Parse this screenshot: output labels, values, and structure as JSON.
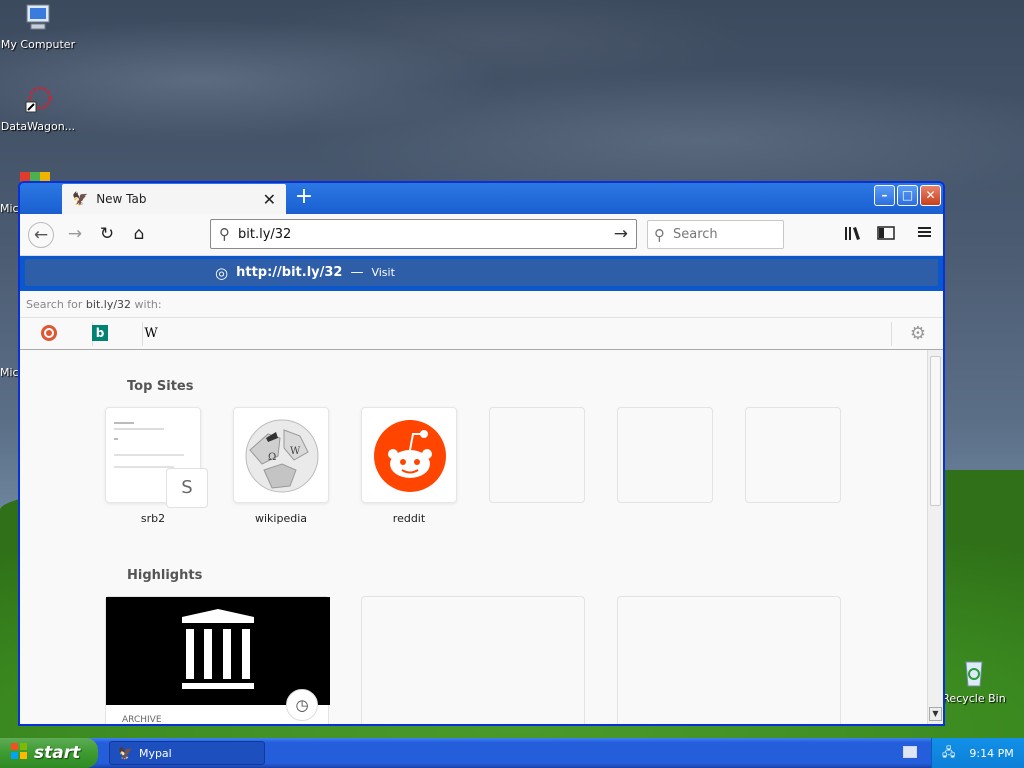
{
  "desktop": {
    "icons": [
      {
        "label": "My Computer"
      },
      {
        "label": "DataWagon..."
      },
      {
        "label": "Mic"
      },
      {
        "label": "Mic"
      },
      {
        "label": "Recycle Bin"
      }
    ]
  },
  "browser": {
    "tab": {
      "title": "New Tab",
      "close": "✕"
    },
    "new_tab": "+",
    "window_controls": {
      "minimize": "–",
      "maximize": "□",
      "close": "✕"
    },
    "url": "bit.ly/32",
    "search_placeholder": "Search",
    "suggestion": {
      "url": "http://bit.ly/32",
      "dash": "—",
      "action": "Visit"
    },
    "search_with": {
      "prefix": "Search for",
      "term": "bit.ly/32",
      "suffix": "with:"
    },
    "engines": [
      {
        "name": "duckduckgo-icon",
        "glyph": "D"
      },
      {
        "name": "bing-icon",
        "glyph": "b"
      },
      {
        "name": "wikipedia-icon",
        "glyph": "W"
      }
    ],
    "newtab": {
      "top_sites_title": "Top Sites",
      "top_sites": [
        {
          "label": "srb2",
          "badge": "S"
        },
        {
          "label": "wikipedia"
        },
        {
          "label": "reddit"
        }
      ],
      "highlights_title": "Highlights",
      "highlights": [
        {
          "label": "ARCHIVE"
        }
      ]
    }
  },
  "taskbar": {
    "start": "start",
    "items": [
      {
        "label": "Mypal"
      }
    ],
    "clock": "9:14 PM"
  },
  "colors": {
    "suggest_bg": "#2f5ea8",
    "reddit": "#ff4500",
    "taskbar": "#245edb",
    "start": "#3c9b30"
  }
}
